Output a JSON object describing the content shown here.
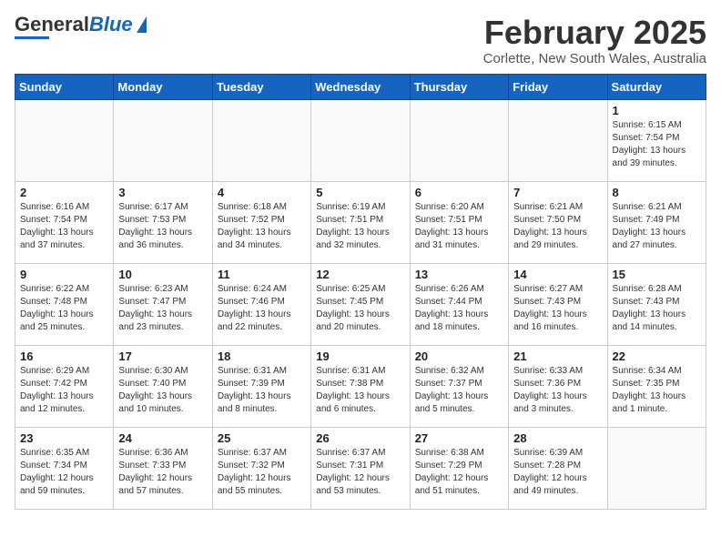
{
  "header": {
    "logo_general": "General",
    "logo_blue": "Blue",
    "month_title": "February 2025",
    "location": "Corlette, New South Wales, Australia"
  },
  "weekdays": [
    "Sunday",
    "Monday",
    "Tuesday",
    "Wednesday",
    "Thursday",
    "Friday",
    "Saturday"
  ],
  "weeks": [
    [
      {
        "day": "",
        "info": ""
      },
      {
        "day": "",
        "info": ""
      },
      {
        "day": "",
        "info": ""
      },
      {
        "day": "",
        "info": ""
      },
      {
        "day": "",
        "info": ""
      },
      {
        "day": "",
        "info": ""
      },
      {
        "day": "1",
        "info": "Sunrise: 6:15 AM\nSunset: 7:54 PM\nDaylight: 13 hours and 39 minutes."
      }
    ],
    [
      {
        "day": "2",
        "info": "Sunrise: 6:16 AM\nSunset: 7:54 PM\nDaylight: 13 hours and 37 minutes."
      },
      {
        "day": "3",
        "info": "Sunrise: 6:17 AM\nSunset: 7:53 PM\nDaylight: 13 hours and 36 minutes."
      },
      {
        "day": "4",
        "info": "Sunrise: 6:18 AM\nSunset: 7:52 PM\nDaylight: 13 hours and 34 minutes."
      },
      {
        "day": "5",
        "info": "Sunrise: 6:19 AM\nSunset: 7:51 PM\nDaylight: 13 hours and 32 minutes."
      },
      {
        "day": "6",
        "info": "Sunrise: 6:20 AM\nSunset: 7:51 PM\nDaylight: 13 hours and 31 minutes."
      },
      {
        "day": "7",
        "info": "Sunrise: 6:21 AM\nSunset: 7:50 PM\nDaylight: 13 hours and 29 minutes."
      },
      {
        "day": "8",
        "info": "Sunrise: 6:21 AM\nSunset: 7:49 PM\nDaylight: 13 hours and 27 minutes."
      }
    ],
    [
      {
        "day": "9",
        "info": "Sunrise: 6:22 AM\nSunset: 7:48 PM\nDaylight: 13 hours and 25 minutes."
      },
      {
        "day": "10",
        "info": "Sunrise: 6:23 AM\nSunset: 7:47 PM\nDaylight: 13 hours and 23 minutes."
      },
      {
        "day": "11",
        "info": "Sunrise: 6:24 AM\nSunset: 7:46 PM\nDaylight: 13 hours and 22 minutes."
      },
      {
        "day": "12",
        "info": "Sunrise: 6:25 AM\nSunset: 7:45 PM\nDaylight: 13 hours and 20 minutes."
      },
      {
        "day": "13",
        "info": "Sunrise: 6:26 AM\nSunset: 7:44 PM\nDaylight: 13 hours and 18 minutes."
      },
      {
        "day": "14",
        "info": "Sunrise: 6:27 AM\nSunset: 7:43 PM\nDaylight: 13 hours and 16 minutes."
      },
      {
        "day": "15",
        "info": "Sunrise: 6:28 AM\nSunset: 7:43 PM\nDaylight: 13 hours and 14 minutes."
      }
    ],
    [
      {
        "day": "16",
        "info": "Sunrise: 6:29 AM\nSunset: 7:42 PM\nDaylight: 13 hours and 12 minutes."
      },
      {
        "day": "17",
        "info": "Sunrise: 6:30 AM\nSunset: 7:40 PM\nDaylight: 13 hours and 10 minutes."
      },
      {
        "day": "18",
        "info": "Sunrise: 6:31 AM\nSunset: 7:39 PM\nDaylight: 13 hours and 8 minutes."
      },
      {
        "day": "19",
        "info": "Sunrise: 6:31 AM\nSunset: 7:38 PM\nDaylight: 13 hours and 6 minutes."
      },
      {
        "day": "20",
        "info": "Sunrise: 6:32 AM\nSunset: 7:37 PM\nDaylight: 13 hours and 5 minutes."
      },
      {
        "day": "21",
        "info": "Sunrise: 6:33 AM\nSunset: 7:36 PM\nDaylight: 13 hours and 3 minutes."
      },
      {
        "day": "22",
        "info": "Sunrise: 6:34 AM\nSunset: 7:35 PM\nDaylight: 13 hours and 1 minute."
      }
    ],
    [
      {
        "day": "23",
        "info": "Sunrise: 6:35 AM\nSunset: 7:34 PM\nDaylight: 12 hours and 59 minutes."
      },
      {
        "day": "24",
        "info": "Sunrise: 6:36 AM\nSunset: 7:33 PM\nDaylight: 12 hours and 57 minutes."
      },
      {
        "day": "25",
        "info": "Sunrise: 6:37 AM\nSunset: 7:32 PM\nDaylight: 12 hours and 55 minutes."
      },
      {
        "day": "26",
        "info": "Sunrise: 6:37 AM\nSunset: 7:31 PM\nDaylight: 12 hours and 53 minutes."
      },
      {
        "day": "27",
        "info": "Sunrise: 6:38 AM\nSunset: 7:29 PM\nDaylight: 12 hours and 51 minutes."
      },
      {
        "day": "28",
        "info": "Sunrise: 6:39 AM\nSunset: 7:28 PM\nDaylight: 12 hours and 49 minutes."
      },
      {
        "day": "",
        "info": ""
      }
    ]
  ]
}
